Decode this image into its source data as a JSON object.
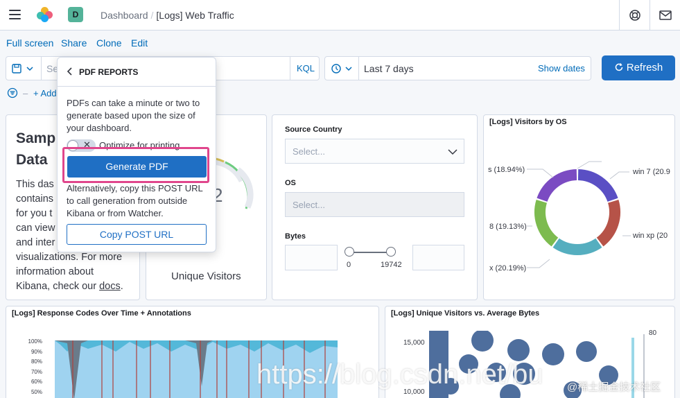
{
  "header": {
    "space_letter": "D",
    "breadcrumb_root": "Dashboard",
    "breadcrumb_sep": "/",
    "breadcrumb_current": "[Logs] Web Traffic"
  },
  "menu": {
    "full_screen": "Full screen",
    "share": "Share",
    "clone": "Clone",
    "edit": "Edit"
  },
  "query": {
    "search_placeholder": "Se",
    "kql": "KQL",
    "time_range": "Last 7 days",
    "show_dates": "Show dates",
    "refresh": "Refresh",
    "add_filter": "+ Add"
  },
  "popover": {
    "title": "PDF REPORTS",
    "description": "PDFs can take a minute or two to generate based upon the size of your dashboard.",
    "optimize_label": "Optimize for printing",
    "generate_button": "Generate PDF",
    "alternative_text": "Alternatively, copy this POST URL to call generation from outside Kibana or from Watcher.",
    "copy_button": "Copy POST URL",
    "highlight_color": "#e0468c"
  },
  "markdown_panel": {
    "title_line1": "Samp",
    "title_line2": "Data",
    "lines": [
      "This das",
      "contains",
      "for you t",
      "can view",
      "and inter",
      "visualizations. For more",
      "information about"
    ],
    "last_line_prefix": "Kibana, check our ",
    "docs_link": "docs",
    "last_line_suffix": "."
  },
  "gauge_panel": {
    "value_partial": "2",
    "caption": "Unique Visitors"
  },
  "controls_panel": {
    "source_country_label": "Source Country",
    "source_country_placeholder": "Select...",
    "os_label": "OS",
    "os_placeholder": "Select...",
    "bytes_label": "Bytes",
    "bytes_min": "0",
    "bytes_max": "19742"
  },
  "os_panel": {
    "title": "[Logs] Visitors by OS",
    "labels": {
      "left_top": "s (18.94%)",
      "left_mid": "8 (19.13%)",
      "left_bottom": "x (20.19%)",
      "right_top": "win 7 (20.9",
      "right_bottom": "win xp (20"
    },
    "colors": [
      "#5a4fc4",
      "#b65348",
      "#55aebf",
      "#7dbb4f",
      "#7b4bc2"
    ]
  },
  "response_panel": {
    "title": "[Logs] Response Codes Over Time + Annotations",
    "y_ticks": [
      "100%",
      "90%",
      "80%",
      "70%",
      "60%",
      "50%"
    ]
  },
  "scatter_panel": {
    "title": "[Logs] Unique Visitors vs. Average Bytes",
    "y_ticks": [
      "15,000",
      "10,000"
    ],
    "right_tick": "80"
  },
  "watermark": {
    "url_text": "https://blog.csdn.net/bu",
    "cn_text": "@稀土掘金技术社区"
  }
}
